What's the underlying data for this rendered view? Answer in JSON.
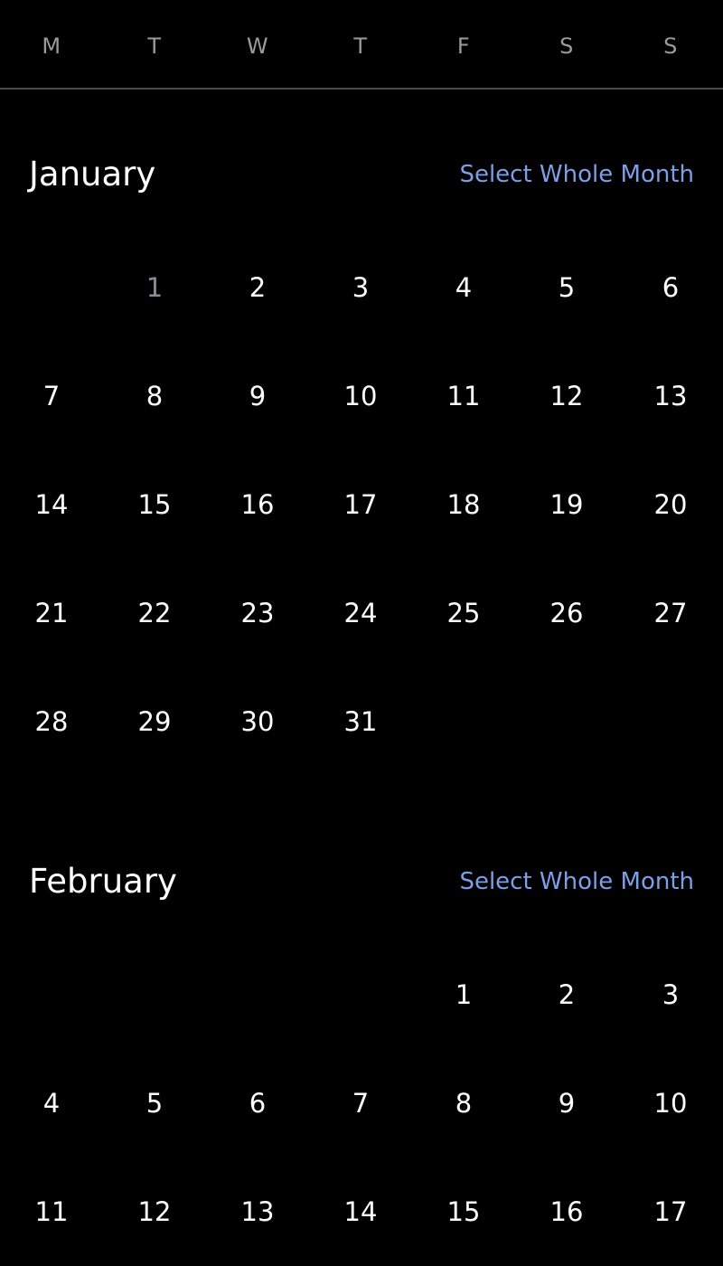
{
  "weekdays": [
    "M",
    "T",
    "W",
    "T",
    "F",
    "S",
    "S"
  ],
  "colors": {
    "background": "#000000",
    "text": "#ffffff",
    "weekday_text": "#9b9b9b",
    "accent_link": "#7b9fe8",
    "disabled_day": "#8a8d93",
    "divider": "#4a4a4a"
  },
  "months": [
    {
      "name": "January",
      "select_label": "Select Whole Month",
      "first_weekday_index": 1,
      "days": [
        {
          "label": "1",
          "state": "disabled"
        },
        {
          "label": "2",
          "state": "enabled"
        },
        {
          "label": "3",
          "state": "enabled"
        },
        {
          "label": "4",
          "state": "enabled"
        },
        {
          "label": "5",
          "state": "enabled"
        },
        {
          "label": "6",
          "state": "enabled"
        },
        {
          "label": "7",
          "state": "enabled"
        },
        {
          "label": "8",
          "state": "enabled"
        },
        {
          "label": "9",
          "state": "enabled"
        },
        {
          "label": "10",
          "state": "enabled"
        },
        {
          "label": "11",
          "state": "enabled"
        },
        {
          "label": "12",
          "state": "enabled"
        },
        {
          "label": "13",
          "state": "enabled"
        },
        {
          "label": "14",
          "state": "enabled"
        },
        {
          "label": "15",
          "state": "enabled"
        },
        {
          "label": "16",
          "state": "enabled"
        },
        {
          "label": "17",
          "state": "enabled"
        },
        {
          "label": "18",
          "state": "enabled"
        },
        {
          "label": "19",
          "state": "enabled"
        },
        {
          "label": "20",
          "state": "enabled"
        },
        {
          "label": "21",
          "state": "enabled"
        },
        {
          "label": "22",
          "state": "enabled"
        },
        {
          "label": "23",
          "state": "enabled"
        },
        {
          "label": "24",
          "state": "enabled"
        },
        {
          "label": "25",
          "state": "enabled"
        },
        {
          "label": "26",
          "state": "enabled"
        },
        {
          "label": "27",
          "state": "enabled"
        },
        {
          "label": "28",
          "state": "enabled"
        },
        {
          "label": "29",
          "state": "enabled"
        },
        {
          "label": "30",
          "state": "enabled"
        },
        {
          "label": "31",
          "state": "enabled"
        }
      ]
    },
    {
      "name": "February",
      "select_label": "Select Whole Month",
      "first_weekday_index": 4,
      "days": [
        {
          "label": "1",
          "state": "enabled"
        },
        {
          "label": "2",
          "state": "enabled"
        },
        {
          "label": "3",
          "state": "enabled"
        },
        {
          "label": "4",
          "state": "enabled"
        },
        {
          "label": "5",
          "state": "enabled"
        },
        {
          "label": "6",
          "state": "enabled"
        },
        {
          "label": "7",
          "state": "enabled"
        },
        {
          "label": "8",
          "state": "enabled"
        },
        {
          "label": "9",
          "state": "enabled"
        },
        {
          "label": "10",
          "state": "enabled"
        },
        {
          "label": "11",
          "state": "enabled"
        },
        {
          "label": "12",
          "state": "enabled"
        },
        {
          "label": "13",
          "state": "enabled"
        },
        {
          "label": "14",
          "state": "enabled"
        },
        {
          "label": "15",
          "state": "enabled"
        },
        {
          "label": "16",
          "state": "enabled"
        },
        {
          "label": "17",
          "state": "enabled"
        }
      ]
    }
  ]
}
